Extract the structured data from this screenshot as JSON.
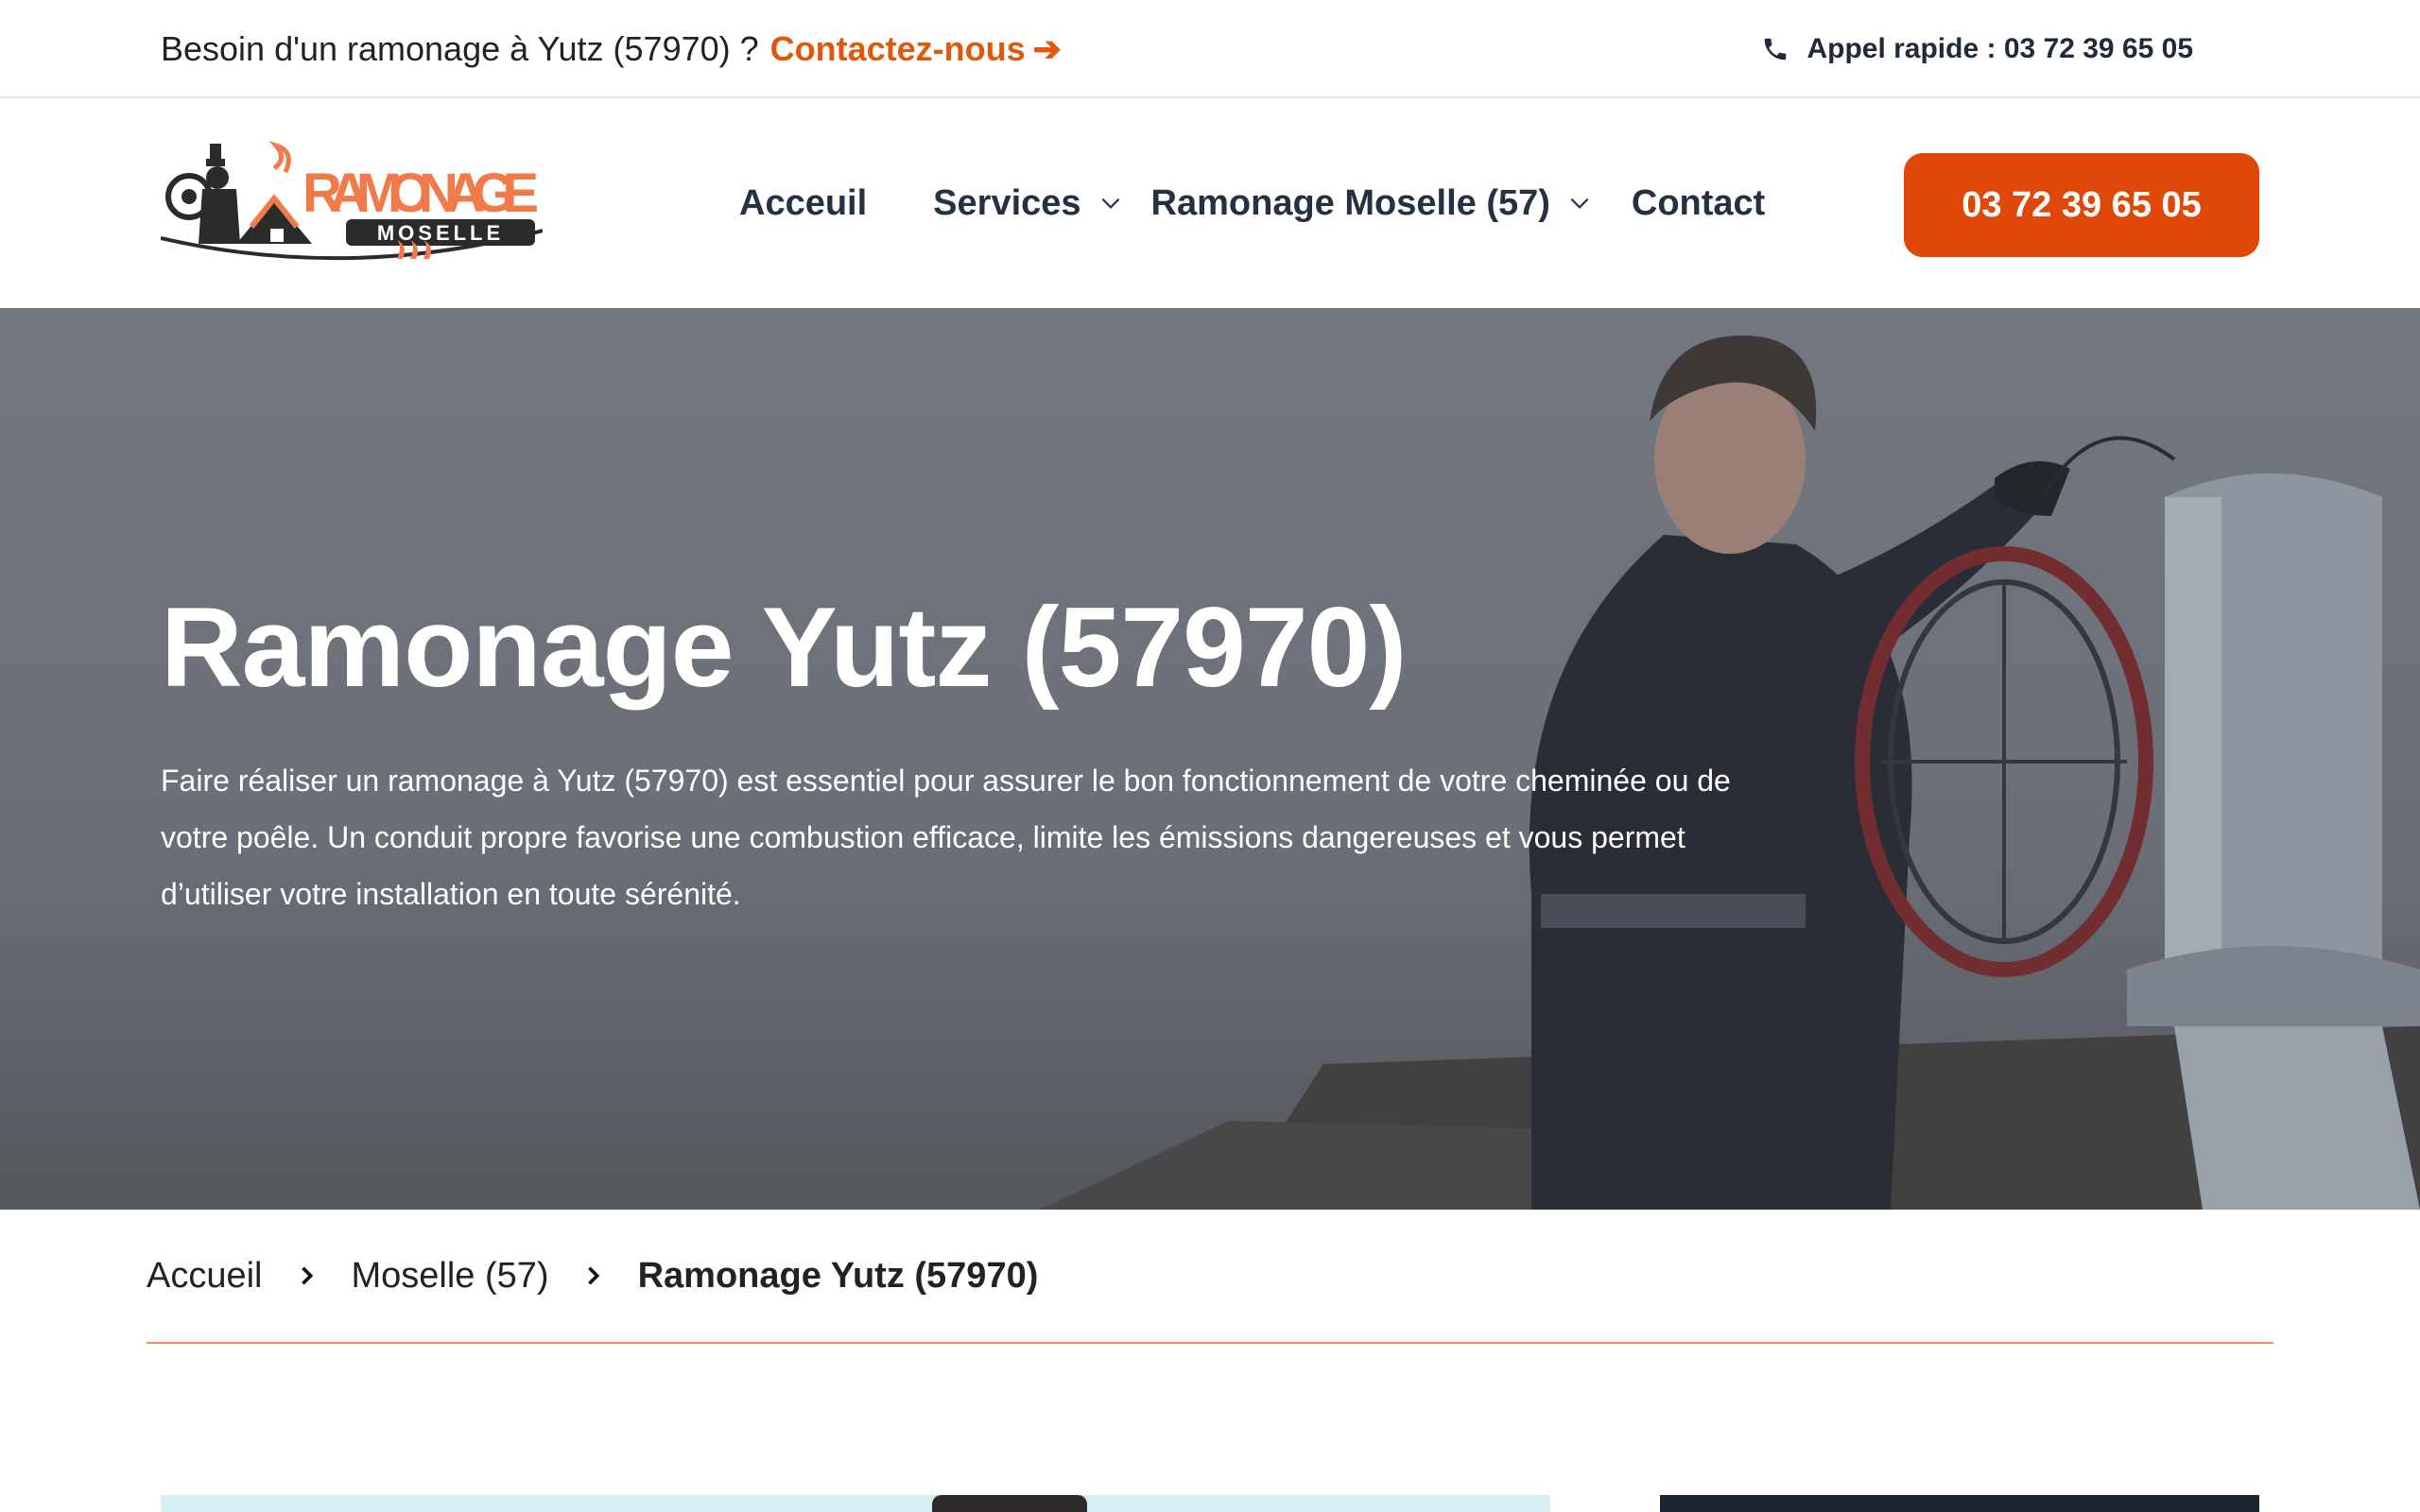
{
  "topbar": {
    "question": "Besoin d'un ramonage à Yutz (57970) ?",
    "contact_link": "Contactez-nous",
    "quick_call": "Appel rapide : 03 72 39 65 05"
  },
  "logo": {
    "name": "RAMONAGE",
    "sub": "MOSELLE"
  },
  "nav": {
    "items": [
      {
        "label": "Acceuil"
      },
      {
        "label": "Services"
      },
      {
        "label": "Ramonage Moselle (57)"
      },
      {
        "label": "Contact"
      }
    ],
    "cta": "03 72 39 65 05"
  },
  "hero": {
    "title": "Ramonage Yutz (57970)",
    "text": "Faire réaliser un ramonage à Yutz (57970) est essentiel pour assurer le bon fonctionnement de votre cheminée ou de votre poêle. Un conduit propre favorise une combustion efficace, limite les émissions dangereuses et vous permet d’utiliser votre installation en toute sérénité."
  },
  "breadcrumb": {
    "home": "Accueil",
    "region": "Moselle (57)",
    "current": "Ramonage Yutz (57970)"
  },
  "colors": {
    "accent": "#e0480a",
    "link": "#e0590a",
    "logo": "#f07a4a",
    "divider": "#ee8a6a"
  }
}
